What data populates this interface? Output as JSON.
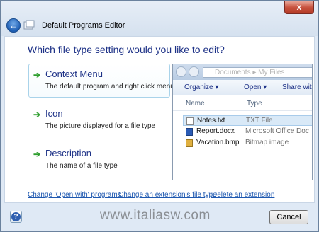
{
  "window": {
    "title": "Default Programs Editor",
    "close_label": "x",
    "back_glyph": "←"
  },
  "question": "Which file type setting would you like to edit?",
  "options": [
    {
      "title": "Context Menu",
      "description": "The default program and right click menu",
      "selected": true
    },
    {
      "title": "Icon",
      "description": "The picture displayed for a file type"
    },
    {
      "title": "Description",
      "description": "The name of a file type"
    }
  ],
  "preview": {
    "path": "Documents ▸ My Files",
    "toolbar": {
      "organize": "Organize ▾",
      "open": "Open ▾",
      "share": "Share with"
    },
    "columns": {
      "name": "Name",
      "type": "Type"
    },
    "files": [
      {
        "name": "Notes.txt",
        "type": "TXT File",
        "icon": "text-file-icon",
        "selected": true
      },
      {
        "name": "Report.docx",
        "type": "Microsoft Office Doc",
        "icon": "word-document-icon"
      },
      {
        "name": "Vacation.bmp",
        "type": "Bitmap image",
        "icon": "bitmap-image-icon"
      }
    ]
  },
  "links": {
    "open_with": "Change 'Open with' programs",
    "extension_type": "Change an extension's file type",
    "delete": "Delete an extension"
  },
  "footer": {
    "help_glyph": "?",
    "watermark": "www.italiasw.com",
    "cancel_label": "Cancel"
  }
}
